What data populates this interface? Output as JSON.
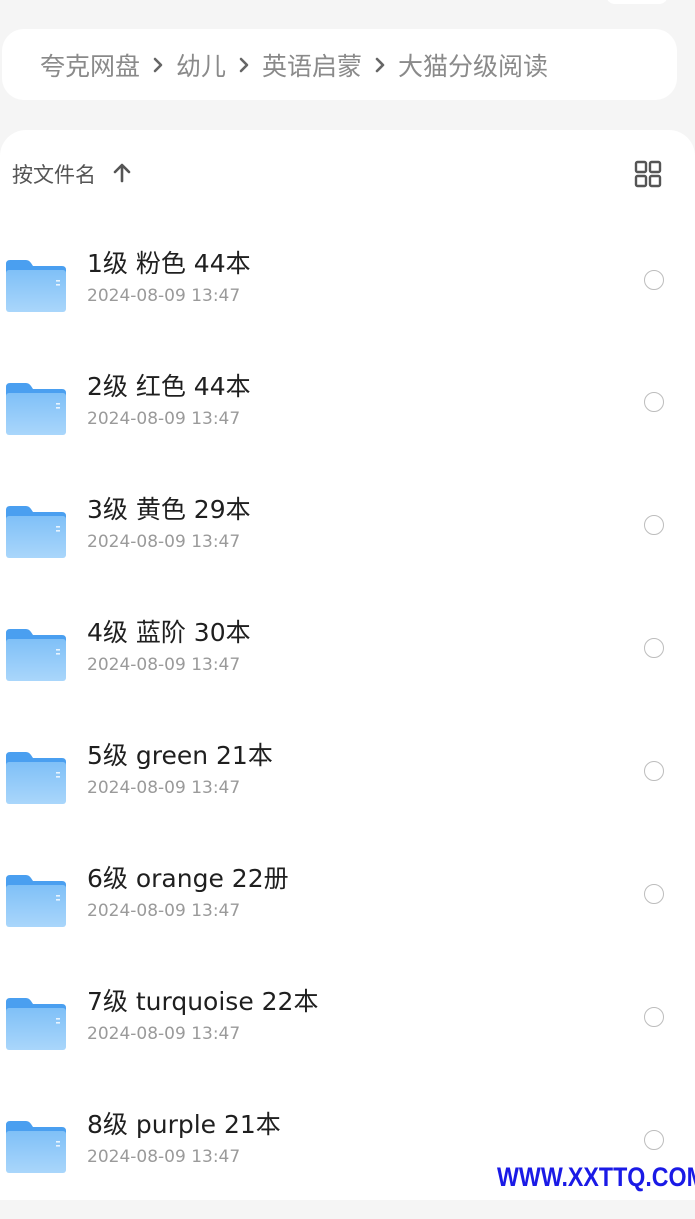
{
  "breadcrumb": {
    "items": [
      "夸克网盘",
      "幼儿",
      "英语启蒙",
      "大猫分级阅读"
    ]
  },
  "sort": {
    "label": "按文件名",
    "direction_icon": "arrow-up-icon"
  },
  "view_toggle": {
    "icon": "grid-view-icon"
  },
  "files": [
    {
      "name": "1级 粉色 44本",
      "date": "2024-08-09 13:47",
      "type": "folder"
    },
    {
      "name": "2级 红色 44本",
      "date": "2024-08-09 13:47",
      "type": "folder"
    },
    {
      "name": "3级 黄色 29本",
      "date": "2024-08-09 13:47",
      "type": "folder"
    },
    {
      "name": "4级 蓝阶 30本",
      "date": "2024-08-09 13:47",
      "type": "folder"
    },
    {
      "name": "5级 green 21本",
      "date": "2024-08-09 13:47",
      "type": "folder"
    },
    {
      "name": "6级 orange 22册",
      "date": "2024-08-09 13:47",
      "type": "folder"
    },
    {
      "name": "7级 turquoise 22本",
      "date": "2024-08-09 13:47",
      "type": "folder"
    },
    {
      "name": "8级 purple 21本",
      "date": "2024-08-09 13:47",
      "type": "folder"
    }
  ],
  "watermark": "WWW.XXTTQ.COM",
  "colors": {
    "folder_blue": "#5aa9f0",
    "watermark_blue": "#1a1ae6"
  }
}
